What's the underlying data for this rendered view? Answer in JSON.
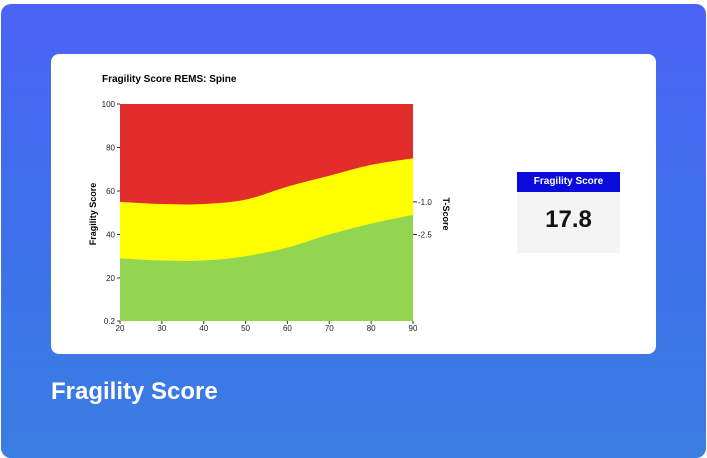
{
  "footer": {
    "title": "Fragility Score"
  },
  "score_card": {
    "header": "Fragility Score",
    "value": "17.8"
  },
  "colors": {
    "high": "#e22d2c",
    "medium": "#ffff00",
    "low": "#92d551",
    "score_header_bg": "#0a0adc"
  },
  "chart_data": {
    "type": "area",
    "title": "Fragility Score REMS: Spine",
    "ylabel": "Fragility Score",
    "y2label": "T-Score",
    "xlim": [
      20,
      90
    ],
    "ylim": [
      0.2,
      100
    ],
    "x_ticks": [
      "20",
      "30",
      "40",
      "50",
      "60",
      "70",
      "80",
      "90"
    ],
    "y_ticks": [
      "100",
      "80",
      "60",
      "40",
      "20",
      "0.2"
    ],
    "y2_ticks": [
      {
        "label": "-1.0",
        "y": 55
      },
      {
        "label": "-2.5",
        "y": 40
      }
    ],
    "bands": [
      {
        "name": "high",
        "color": "#e22d2c"
      },
      {
        "name": "medium",
        "color": "#ffff00"
      },
      {
        "name": "low",
        "color": "#92d551"
      }
    ],
    "x": [
      20,
      30,
      40,
      50,
      60,
      70,
      80,
      90
    ],
    "upper_boundary": [
      55,
      54,
      54,
      56,
      62,
      67,
      72,
      75
    ],
    "lower_boundary": [
      29,
      28,
      28,
      30,
      34,
      40,
      45,
      49
    ]
  }
}
